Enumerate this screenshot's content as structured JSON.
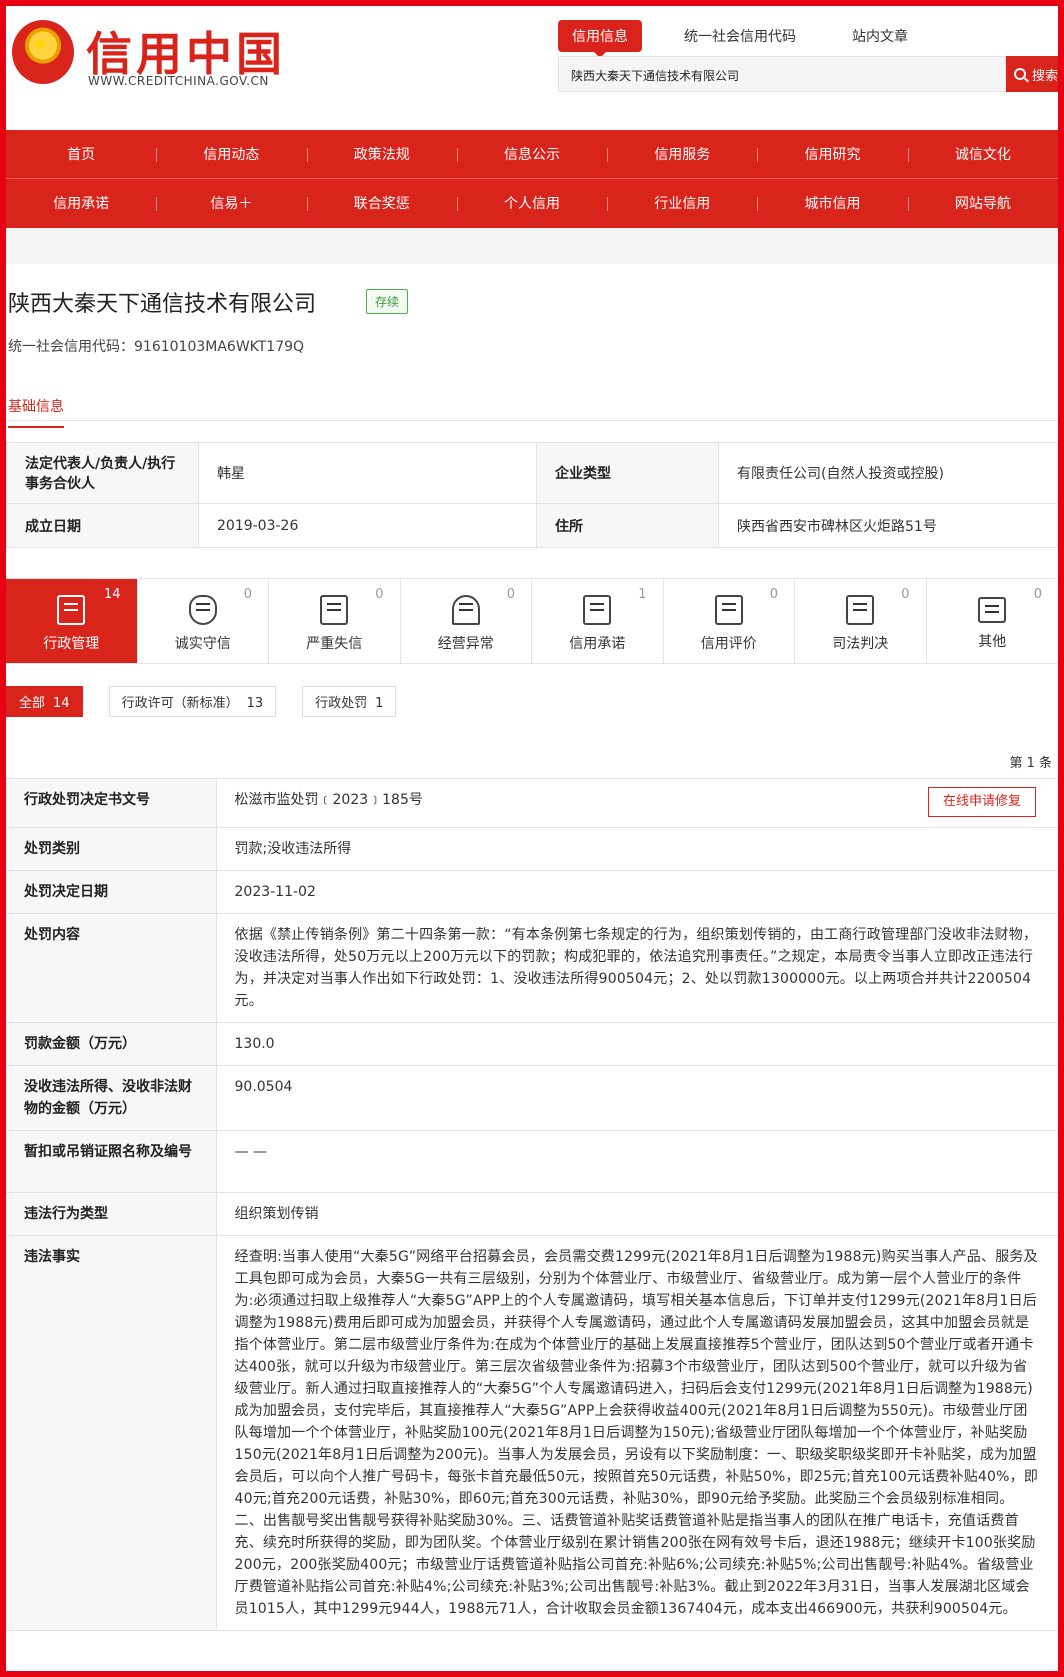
{
  "header": {
    "logo_title": "信用中国",
    "logo_subtitle": "WWW.CREDITCHINA.GOV.CN",
    "search_tabs": [
      "信用信息",
      "统一社会信用代码",
      "站内文章"
    ],
    "search_value": "陕西大秦天下通信技术有限公司",
    "search_button": "搜索"
  },
  "nav": {
    "row1": [
      "首页",
      "信用动态",
      "政策法规",
      "信息公示",
      "信用服务",
      "信用研究",
      "诚信文化"
    ],
    "row2": [
      "信用承诺",
      "信易＋",
      "联合奖惩",
      "个人信用",
      "行业信用",
      "城市信用",
      "网站导航"
    ]
  },
  "company": {
    "name": "陕西大秦天下通信技术有限公司",
    "status": "存续",
    "credit_code": "统一社会信用代码：91610103MA6WKT179Q",
    "basic_tab": "基础信息"
  },
  "basic_info": {
    "legal_rep_label": "法定代表人/负责人/执行事务合伙人",
    "legal_rep_value": "韩星",
    "type_label": "企业类型",
    "type_value": "有限责任公司(自然人投资或控股)",
    "founded_label": "成立日期",
    "founded_value": "2019-03-26",
    "address_label": "住所",
    "address_value": "陕西省西安市碑林区火炬路51号"
  },
  "categories": [
    {
      "label": "行政管理",
      "count": "14"
    },
    {
      "label": "诚实守信",
      "count": "0"
    },
    {
      "label": "严重失信",
      "count": "0"
    },
    {
      "label": "经营异常",
      "count": "0"
    },
    {
      "label": "信用承诺",
      "count": "1"
    },
    {
      "label": "信用评价",
      "count": "0"
    },
    {
      "label": "司法判决",
      "count": "0"
    },
    {
      "label": "其他",
      "count": "0"
    }
  ],
  "filters": [
    {
      "label": "全部",
      "count": "14"
    },
    {
      "label": "行政许可（新标准）",
      "count": "13"
    },
    {
      "label": "行政处罚",
      "count": "1"
    }
  ],
  "record_count": "第 1 条",
  "detail": {
    "doc_no_label": "行政处罚决定书文号",
    "doc_no_value": "松滋市监处罚﹝2023﹞185号",
    "repair_button": "在线申请修复",
    "category_label": "处罚类别",
    "category_value": "罚款;没收违法所得",
    "date_label": "处罚决定日期",
    "date_value": "2023-11-02",
    "content_label": "处罚内容",
    "content_value": "依据《禁止传销条例》第二十四条第一款：“有本条例第七条规定的行为，组织策划传销的，由工商行政管理部门没收非法财物，没收违法所得，处50万元以上200万元以下的罚款；构成犯罪的，依法追究刑事责任。”之规定，本局责令当事人立即改正违法行为，并决定对当事人作出如下行政处罚：1、没收违法所得900504元；2、处以罚款1300000元。以上两项合并共计2200504元。",
    "fine_label": "罚款金额（万元）",
    "fine_value": "130.0",
    "confiscate_label": "没收违法所得、没收非法财物的金额（万元）",
    "confiscate_value": "90.0504",
    "license_label": "暂扣或吊销证照名称及编号",
    "license_value": "— —",
    "violation_type_label": "违法行为类型",
    "violation_type_value": "组织策划传销",
    "facts_label": "违法事实",
    "facts_value": "经查明:当事人使用“大秦5G”网络平台招募会员，会员需交费1299元(2021年8月1日后调整为1988元)购买当事人产品、服务及工具包即可成为会员，大秦5G一共有三层级别，分别为个体营业厅、市级营业厅、省级营业厅。成为第一层个人营业厅的条件为:必须通过扫取上级推荐人“大秦5G”APP上的个人专属邀请码，填写相关基本信息后，下订单并支付1299元(2021年8月1日后调整为1988元)费用后即可成为加盟会员，并获得个人专属邀请码，通过此个人专属邀请码发展加盟会员，这其中加盟会员就是指个体营业厅。第二层市级营业厅条件为:在成为个体营业厅的基础上发展直接推荐5个营业厅，团队达到50个营业厅或者开通卡达400张，就可以升级为市级营业厅。第三层次省级营业条件为:招募3个市级营业厅，团队达到500个营业厅，就可以升级为省级营业厅。新人通过扫取直接推荐人的“大秦5G”个人专属邀请码进入，扫码后会支付1299元(2021年8月1日后调整为1988元)成为加盟会员，支付完毕后，其直接推荐人“大秦5G”APP上会获得收益400元(2021年8月1日后调整为550元)。市级营业厅团队每增加一个个体营业厅，补贴奖励100元(2021年8月1日后调整为150元);省级营业厅团队每增加一个个体营业厅，补贴奖励150元(2021年8月1日后调整为200元)。当事人为发展会员，另设有以下奖励制度：一、职级奖职级奖即开卡补贴奖，成为加盟会员后，可以向个人推广号码卡，每张卡首充最低50元，按照首充50元话费，补贴50%，即25元;首充100元话费补贴40%，即40元;首充200元话费，补贴30%，即60元;首充300元话费，补贴30%，即90元给予奖励。此奖励三个会员级别标准相同。二、出售靓号奖出售靓号获得补贴奖励30%。三、话费管道补贴奖话费管道补贴是指当事人的团队在推广电话卡，充值话费首充、续充时所获得的奖励，即为团队奖。个体营业厅级别在累计销售200张在网有效号卡后，退还1988元；继续开卡100张奖励200元，200张奖励400元；市级营业厅话费管道补贴指公司首充:补贴6%;公司续充:补贴5%;公司出售靓号:补贴4%。省级营业厅费管道补贴指公司首充:补贴4%;公司续充:补贴3%;公司出售靓号:补贴3%。截止到2022年3月31日，当事人发展湖北区域会员1015人，其中1299元944人，1988元71人，合计收取会员金额1367404元，成本支出466900元，共获利900504元。"
  },
  "colors": {
    "brand_red": "#d9241c",
    "status_green": "#3a9a3e"
  }
}
